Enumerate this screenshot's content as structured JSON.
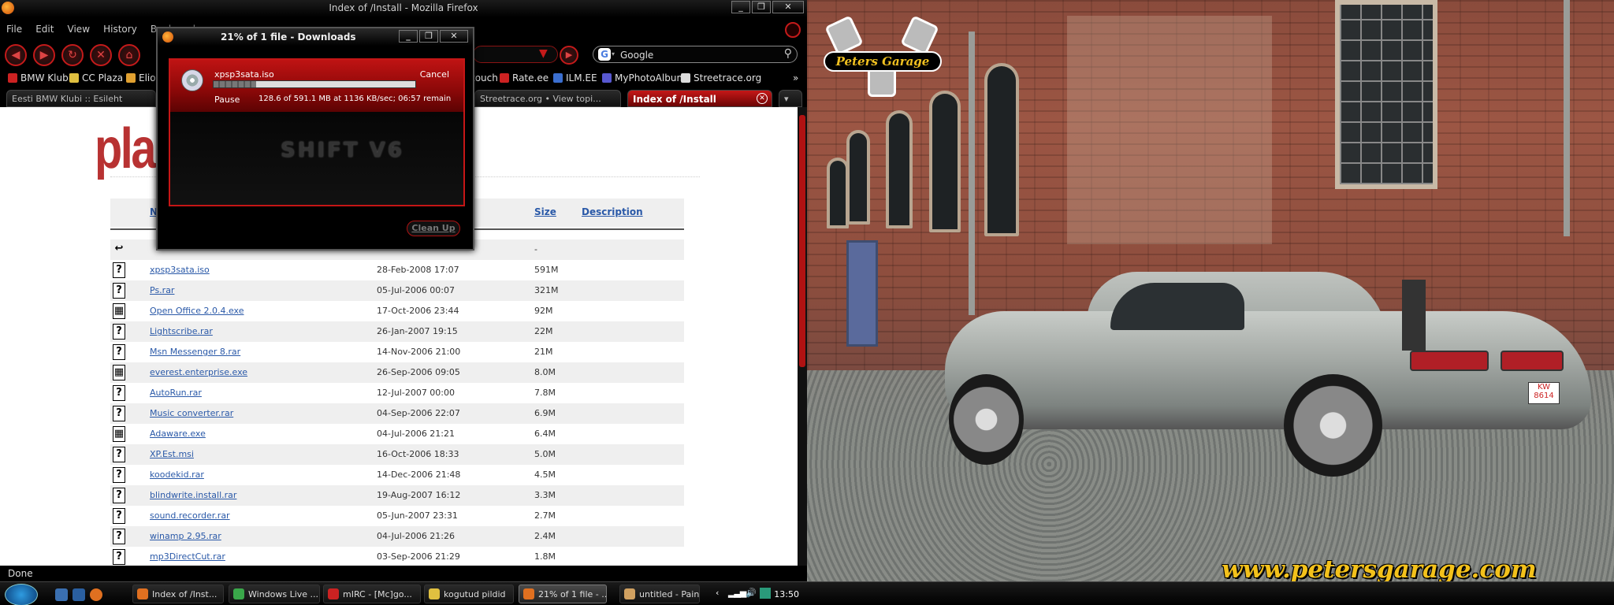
{
  "firefox": {
    "title": "Index of /Install - Mozilla Firefox",
    "menu": [
      "File",
      "Edit",
      "View",
      "History",
      "Bookmarks"
    ],
    "search_engine": "Google",
    "bookmarks": [
      "BMW Klubi",
      "CC Plaza",
      "Elio",
      "touch",
      "Rate.ee",
      "ILM.EE",
      "MyPhotoAlbum",
      "Streetrace.org"
    ],
    "tabs": [
      {
        "label": "Eesti BMW Klubi :: Esileht",
        "active": false
      },
      {
        "label": "Streetrace.org • View topi...",
        "active": false
      },
      {
        "label": "Index of /Install",
        "active": true
      }
    ],
    "status": "Done"
  },
  "page": {
    "brand": "plan",
    "columns": {
      "name": "N",
      "size": "Size",
      "description": "Description"
    },
    "parent_size": "-",
    "files": [
      {
        "name": "xpsp3sata.iso",
        "date": "28-Feb-2008 17:07",
        "size": "591M",
        "icon": "?"
      },
      {
        "name": "Ps.rar",
        "date": "05-Jul-2006 00:07",
        "size": "321M",
        "icon": "?"
      },
      {
        "name": "Open Office 2.0.4.exe",
        "date": "17-Oct-2006 23:44",
        "size": "92M",
        "icon": "▦"
      },
      {
        "name": "Lightscribe.rar",
        "date": "26-Jan-2007 19:15",
        "size": "22M",
        "icon": "?"
      },
      {
        "name": "Msn Messenger 8.rar",
        "date": "14-Nov-2006 21:00",
        "size": "21M",
        "icon": "?"
      },
      {
        "name": "everest.enterprise.exe",
        "date": "26-Sep-2006 09:05",
        "size": "8.0M",
        "icon": "▦"
      },
      {
        "name": "AutoRun.rar",
        "date": "12-Jul-2007 00:00",
        "size": "7.8M",
        "icon": "?"
      },
      {
        "name": "Music converter.rar",
        "date": "04-Sep-2006 22:07",
        "size": "6.9M",
        "icon": "?"
      },
      {
        "name": "Adaware.exe",
        "date": "04-Jul-2006 21:21",
        "size": "6.4M",
        "icon": "▦"
      },
      {
        "name": "XP.Est.msi",
        "date": "16-Oct-2006 18:33",
        "size": "5.0M",
        "icon": "?"
      },
      {
        "name": "koodekid.rar",
        "date": "14-Dec-2006 21:48",
        "size": "4.5M",
        "icon": "?"
      },
      {
        "name": "blindwrite.install.rar",
        "date": "19-Aug-2007 16:12",
        "size": "3.3M",
        "icon": "?"
      },
      {
        "name": "sound.recorder.rar",
        "date": "05-Jun-2007 23:31",
        "size": "2.7M",
        "icon": "?"
      },
      {
        "name": "winamp 2.95.rar",
        "date": "04-Jul-2006 21:26",
        "size": "2.4M",
        "icon": "?"
      },
      {
        "name": "mp3DirectCut.rar",
        "date": "03-Sep-2006 21:29",
        "size": "1.8M",
        "icon": "?"
      }
    ]
  },
  "downloads": {
    "title": "21% of 1 file - Downloads",
    "file": "xpsp3sata.iso",
    "cancel": "Cancel",
    "pause": "Pause",
    "status": "128.6 of 591.1 MB at 1136 KB/sec; 06:57 remain",
    "progress_fraction": 0.21,
    "watermark": "SHIFT V6",
    "clean_up": "Clean Up"
  },
  "desktop": {
    "logo_text": "Peters Garage",
    "url_text": "www.petersgarage.com",
    "plate_text": "KW 8614"
  },
  "taskbar": {
    "tasks": [
      {
        "label": "Index of /Inst...",
        "active": false,
        "color": "#e07020"
      },
      {
        "label": "Windows Live ...",
        "active": false,
        "color": "#3aa84a"
      },
      {
        "label": "mIRC - [Mc]go...",
        "active": false,
        "color": "#c22"
      },
      {
        "label": "kogutud pildid",
        "active": false,
        "color": "#e0c040"
      },
      {
        "label": "21% of 1 file - ...",
        "active": true,
        "color": "#e07020"
      },
      {
        "label": "untitled - Paint",
        "active": false,
        "color": "#d0a060"
      }
    ],
    "clock": "13:50"
  }
}
